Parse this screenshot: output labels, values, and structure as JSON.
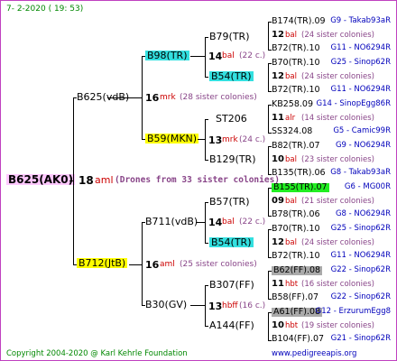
{
  "header": {
    "date": "7-   2-2020  ( 19:  53)"
  },
  "footer": {
    "copyright": "Copyright 2004-2020 @ Karl Kehrle Foundation",
    "site": "www.pedigreeapis.org"
  },
  "root": {
    "name": "B625(AK0)",
    "num": "18",
    "abbr": "aml",
    "note": "(Drones from 33 sister colonies)"
  },
  "gen1": [
    {
      "name": "B625(vdB)",
      "num": "16",
      "abbr": "mrk",
      "note": "(28 sister colonies)"
    },
    {
      "name": "B712(JtB)",
      "num": "16",
      "abbr": "aml",
      "note": "(25 sister colonies)"
    }
  ],
  "gen2": [
    {
      "name": "B98(TR)",
      "num": "14",
      "abbr": "bal",
      "note": "(22 c.)"
    },
    {
      "name": "B59(MKN)",
      "num": "13",
      "abbr": "mrk",
      "note": "(24 c.)"
    },
    {
      "name": "B711(vdB)",
      "num": "14",
      "abbr": "bal",
      "note": "(22 c.)"
    },
    {
      "name": "B30(GV)",
      "num": "13",
      "abbr": "hbff",
      "note": "(16 c.)"
    }
  ],
  "gen3": [
    {
      "name": "B79(TR)",
      "num": ""
    },
    {
      "name": "B54(TR)",
      "num": ""
    },
    {
      "name": "ST206",
      "num": ""
    },
    {
      "name": "B129(TR)",
      "num": ""
    },
    {
      "name": "B57(TR)",
      "num": ""
    },
    {
      "name": "B54(TR)",
      "num": ""
    },
    {
      "name": "B307(FF)",
      "num": ""
    },
    {
      "name": "A144(FF)",
      "num": ""
    }
  ],
  "gen4": [
    {
      "top": "B174(TR).09",
      "topinfo": "G9 - Takab93aR",
      "mid_num": "12",
      "mid_abbr": "bal",
      "mid_note": "(24 sister colonies)",
      "bot": "B72(TR).10",
      "botinfo": "G11 - NO6294R"
    },
    {
      "top": "B70(TR).10",
      "topinfo": "G25 - Sinop62R",
      "mid_num": "12",
      "mid_abbr": "bal",
      "mid_note": "(24 sister colonies)",
      "bot": "B72(TR).10",
      "botinfo": "G11 - NO6294R"
    },
    {
      "top": "KB258.09",
      "topinfo": "G14 - SinopEgg86R",
      "mid_num": "11",
      "mid_abbr": "alr",
      "mid_note": "(14 sister colonies)",
      "bot": "SS324.08",
      "botinfo": "G5 - Camic99R"
    },
    {
      "top": "B82(TR).07",
      "topinfo": "G9 - NO6294R",
      "mid_num": "10",
      "mid_abbr": "bal",
      "mid_note": "(23 sister colonies)",
      "bot": "B135(TR).06",
      "botinfo": "G8 - Takab93aR"
    },
    {
      "top": "B155(TR).07",
      "topinfo": "G6 - MG00R",
      "mid_num": "09",
      "mid_abbr": "bal",
      "mid_note": "(21 sister colonies)",
      "bot": "B78(TR).06",
      "botinfo": "G8 - NO6294R"
    },
    {
      "top": "B70(TR).10",
      "topinfo": "G25 - Sinop62R",
      "mid_num": "12",
      "mid_abbr": "bal",
      "mid_note": "(24 sister colonies)",
      "bot": "B72(TR).10",
      "botinfo": "G11 - NO6294R"
    },
    {
      "top": "B62(FF).08",
      "topinfo": "G22 - Sinop62R",
      "mid_num": "11",
      "mid_abbr": "hbt",
      "mid_note": "(16 sister colonies)",
      "bot": "B58(FF).07",
      "botinfo": "G22 - Sinop62R"
    },
    {
      "top": "A61(FF).08",
      "topinfo": "G12 - ErzurumEgg8",
      "mid_num": "10",
      "mid_abbr": "hbt",
      "mid_note": "(19 sister colonies)",
      "bot": "B104(FF).07",
      "botinfo": "G21 - Sinop62R"
    }
  ]
}
